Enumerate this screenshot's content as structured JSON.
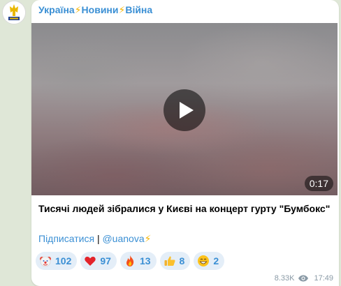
{
  "channel": {
    "name_parts": [
      "Україна",
      "Новини",
      "Війна"
    ],
    "separator_icon": "lightning-icon",
    "avatar_icon": "trident-shield-icon",
    "accent_color": "#3a8fd4"
  },
  "video": {
    "duration": "0:17",
    "play_icon": "play-icon"
  },
  "post": {
    "headline": "Тисячі людей зібралися у Києві на концерт гурту \"Бумбокс\"",
    "subscribe_label": "Підписатися",
    "separator": "|",
    "handle": "@uanova"
  },
  "reactions": [
    {
      "icon": "clown-face-icon",
      "count": "102"
    },
    {
      "icon": "red-heart-icon",
      "count": "97"
    },
    {
      "icon": "fire-icon",
      "count": "13"
    },
    {
      "icon": "thumbs-up-icon",
      "count": "8"
    },
    {
      "icon": "grinning-face-icon",
      "count": "2"
    }
  ],
  "meta": {
    "views": "8.33K",
    "time": "17:49",
    "views_icon": "eye-icon"
  }
}
